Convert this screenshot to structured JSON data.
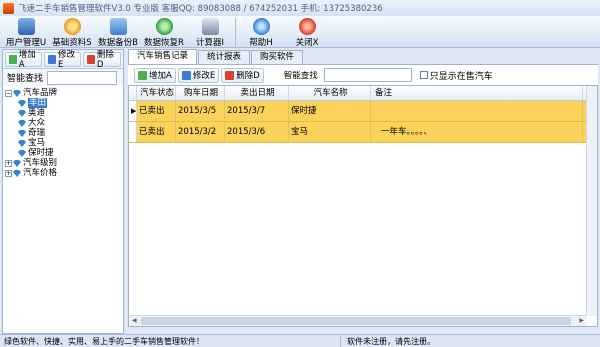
{
  "window": {
    "title": "飞速二手车销售管理软件V3.0 专业版  客服QQ: 89083088 / 674252031  手机: 13725380236"
  },
  "toolbar": {
    "buttons": [
      {
        "label": "用户管理U",
        "icon": "users-icon",
        "color": "#3a78c9"
      },
      {
        "label": "基础资料S",
        "icon": "gear-icon",
        "color": "#e6a21a"
      },
      {
        "label": "数据备份B",
        "icon": "database-backup-icon",
        "color": "#4a8fd6"
      },
      {
        "label": "数据恢复R",
        "icon": "refresh-icon",
        "color": "#2fa54a"
      },
      {
        "label": "计算器I",
        "icon": "calculator-icon",
        "color": "#6a7fa0"
      },
      {
        "label": "帮助H",
        "icon": "help-icon",
        "color": "#3f8fe0"
      },
      {
        "label": "关闭X",
        "icon": "close-icon",
        "color": "#e0452f"
      }
    ]
  },
  "left": {
    "add_label": "增加A",
    "edit_label": "修改E",
    "delete_label": "删除D",
    "search_label": "智能查找",
    "tree": {
      "root": "汽车品牌",
      "children": [
        "丰田",
        "奥迪",
        "大众",
        "奇瑞",
        "宝马",
        "保时捷"
      ],
      "others": [
        "汽车级别",
        "汽车价格"
      ]
    }
  },
  "right": {
    "tabs": [
      "汽车销售记录",
      "统计报表",
      "购买软件"
    ],
    "add_label": "增加A",
    "edit_label": "修改E",
    "delete_label": "删除D",
    "search_label": "智能查找",
    "only_sale_label": "只显示在售汽车",
    "columns": [
      "汽车状态",
      "购车日期",
      "卖出日期",
      "汽车名称",
      "备注"
    ],
    "rows": [
      {
        "status": "已卖出",
        "buy": "2015/3/5",
        "sell": "2015/3/7",
        "name": "保时捷",
        "note": ""
      },
      {
        "status": "已卖出",
        "buy": "2015/3/2",
        "sell": "2015/3/6",
        "name": "宝马",
        "note": "一年车。。。。、"
      }
    ],
    "row_color": "#fbd25a"
  },
  "status": {
    "left": "绿色软件、快捷、实用、易上手的二手车销售管理软件！",
    "right": "软件未注册，请先注册。"
  }
}
